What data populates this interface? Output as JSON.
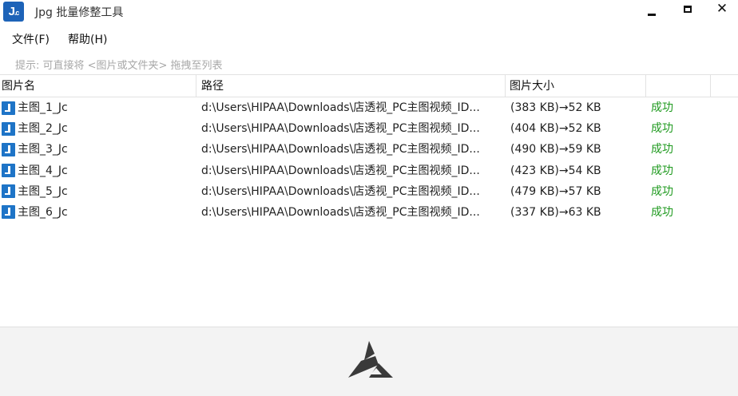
{
  "window": {
    "app_icon_text": "J",
    "app_icon_sub": ".c",
    "title": "Jpg 批量修整工具",
    "controls": {
      "minimize": "minimize",
      "maximize": "maximize",
      "close": "✕"
    }
  },
  "menu": [
    {
      "label": "文件(F)"
    },
    {
      "label": "帮助(H)"
    }
  ],
  "hint": "提示: 可直接将 <图片或文件夹> 拖拽至列表",
  "table": {
    "columns": [
      "图片名",
      "路径",
      "图片大小",
      ""
    ],
    "rows": [
      {
        "name": "主图_1_Jc",
        "path": "d:\\Users\\HIPAA\\Downloads\\店透视_PC主图视频_ID...",
        "size": "(383 KB)→52 KB",
        "status": "成功"
      },
      {
        "name": "主图_2_Jc",
        "path": "d:\\Users\\HIPAA\\Downloads\\店透视_PC主图视频_ID...",
        "size": "(404 KB)→52 KB",
        "status": "成功"
      },
      {
        "name": "主图_3_Jc",
        "path": "d:\\Users\\HIPAA\\Downloads\\店透视_PC主图视频_ID...",
        "size": "(490 KB)→59 KB",
        "status": "成功"
      },
      {
        "name": "主图_4_Jc",
        "path": "d:\\Users\\HIPAA\\Downloads\\店透视_PC主图视频_ID...",
        "size": "(423 KB)→54 KB",
        "status": "成功"
      },
      {
        "name": "主图_5_Jc",
        "path": "d:\\Users\\HIPAA\\Downloads\\店透视_PC主图视频_ID...",
        "size": "(479 KB)→57 KB",
        "status": "成功"
      },
      {
        "name": "主图_6_Jc",
        "path": "d:\\Users\\HIPAA\\Downloads\\店透视_PC主图视频_ID...",
        "size": "(337 KB)→63 KB",
        "status": "成功"
      }
    ]
  },
  "colors": {
    "app_icon": "#1d63b8",
    "file_icon": "#1e74c7",
    "success": "#1f9a1f",
    "hint": "#a8a8a8",
    "footer_bg": "#f3f3f3",
    "logo": "#3a3a3a"
  },
  "icons": {
    "app": "app-logo-icon",
    "file": "jpg-file-icon",
    "footer": "triangle-logo-icon"
  }
}
